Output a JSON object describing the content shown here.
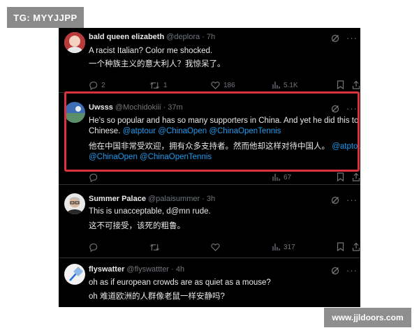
{
  "watermark_top": "TG: MYYJJPP",
  "watermark_bottom": "www.jjldoors.com",
  "colors": {
    "background": "#000000",
    "text": "#e7e9ea",
    "muted": "#71767b",
    "link": "#1d9bf0",
    "highlight": "#d9323a"
  },
  "tweets": [
    {
      "name": "bald queen elizabeth",
      "handle": "@deplora",
      "time": "· 7h",
      "line1": "A racist Italian? Color me shocked.",
      "line2": "一个种族主义的意大利人？我惊呆了。",
      "replies": "2",
      "retweets": "1",
      "likes": "186",
      "views": "5.1K",
      "avatar_icon": "bald-person-avatar"
    },
    {
      "name": "Uwsss",
      "handle": "@Mochidokiii",
      "time": "· 37m",
      "line1": "He's so popular and has so many supporters in China. And yet he did this to",
      "line2_text": "Chinese. ",
      "line2_links": "@atptour @ChinaOpen @ChinaOpenTennis",
      "line3_text": "他在中国非常受欢迎，拥有众多支持者。然而他却这样对待中国人。",
      "line3_link": " @atptour",
      "line4_links": "@ChinaOpen @ChinaOpenTennis",
      "views": "67",
      "avatar_icon": "landscape-avatar"
    },
    {
      "name": "Summer Palace",
      "handle": "@palaisummer",
      "time": "· 3h",
      "line1": "This is unacceptable, d@mn rude.",
      "line2": "这不可接受，该死的粗鲁。",
      "views": "317",
      "avatar_icon": "glasses-man-avatar"
    },
    {
      "name": "flyswatter",
      "handle": "@flyswattter",
      "time": "· 4h",
      "line1": "oh as if european crowds are as quiet as a mouse?",
      "line2": "oh 难道欧洲的人群像老鼠一样安静吗?",
      "avatar_icon": "flyswatter-avatar"
    }
  ]
}
